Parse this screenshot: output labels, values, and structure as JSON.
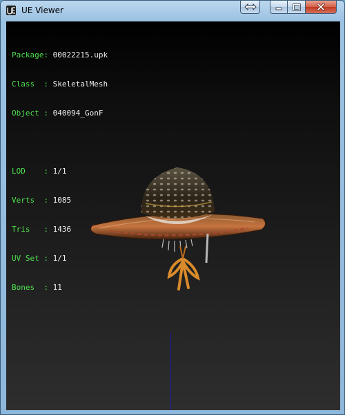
{
  "window": {
    "title": "UE Viewer",
    "buttons": {
      "swap": "swap-icon",
      "minimize": "minimize-icon",
      "maximize": "maximize-icon",
      "close": "close-icon"
    }
  },
  "info": {
    "package": {
      "label": "Package:",
      "value": "00022215.upk"
    },
    "class": {
      "label": "Class  :",
      "value": "SkeletalMesh"
    },
    "object": {
      "label": "Object :",
      "value": "040094_GonF"
    },
    "lod": {
      "label": "LOD    :",
      "value": "1/1"
    },
    "verts": {
      "label": "Verts  :",
      "value": "1085"
    },
    "tris": {
      "label": "Tris   :",
      "value": "1436"
    },
    "uvset": {
      "label": "UV Set :",
      "value": "1/1"
    },
    "bones": {
      "label": "Bones  :",
      "value": "11"
    }
  },
  "colors": {
    "label": "#4ee24e",
    "value": "#f0f0f0",
    "viewport_bg": "#1c1c1c",
    "axis": "#1a1aa0"
  }
}
